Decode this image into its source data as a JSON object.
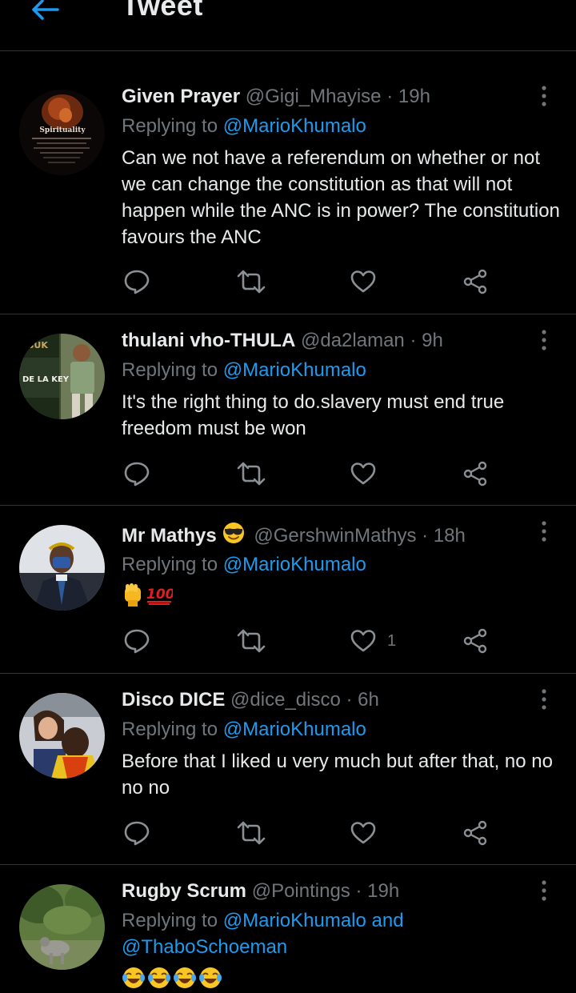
{
  "header": {
    "title": "Tweet"
  },
  "tweets": [
    {
      "name": "Given Prayer",
      "handle": "@Gigi_Mhayise",
      "dot": "·",
      "time": "19h",
      "replying_prefix": "Replying to ",
      "replying_to": "@MarioKhumalo",
      "text": "Can we not have a referendum on whether or not we can change the constitution as that will not happen while the ANC is in power? The constitution favours the ANC",
      "avatar_caption": "Spirituality"
    },
    {
      "name": "thulani vho-THULA",
      "handle": "@da2laman",
      "dot": "·",
      "time": "9h",
      "replying_prefix": "Replying to ",
      "replying_to": "@MarioKhumalo",
      "text": "It's the right thing to do.slavery must end true freedom must be won"
    },
    {
      "name": "Mr Mathys",
      "name_emoji": "smiling-face-with-sunglasses",
      "handle": "@GershwinMathys",
      "dot": "·",
      "time": "18h",
      "replying_prefix": "Replying to ",
      "replying_to": "@MarioKhumalo",
      "text_emojis": [
        "raised-fist",
        "hundred-points"
      ],
      "like_count": "1"
    },
    {
      "name": "Disco DICE",
      "handle": "@dice_disco",
      "dot": "·",
      "time": "6h",
      "replying_prefix": "Replying to ",
      "replying_to": "@MarioKhumalo",
      "text": "Before that I liked u very much but after that, no no no no"
    },
    {
      "name": "Rugby Scrum",
      "handle": "@Pointings",
      "dot": "·",
      "time": "19h",
      "replying_prefix": "Replying to ",
      "replying_to": "@MarioKhumalo and",
      "replying_to_2": "@ThaboSchoeman",
      "text_emojis": [
        "tears-of-joy",
        "tears-of-joy",
        "tears-of-joy",
        "tears-of-joy"
      ]
    }
  ],
  "colors": {
    "background": "#000000",
    "accent": "#1d9bf0",
    "secondary": "#71767b",
    "divider": "#2f3336"
  }
}
